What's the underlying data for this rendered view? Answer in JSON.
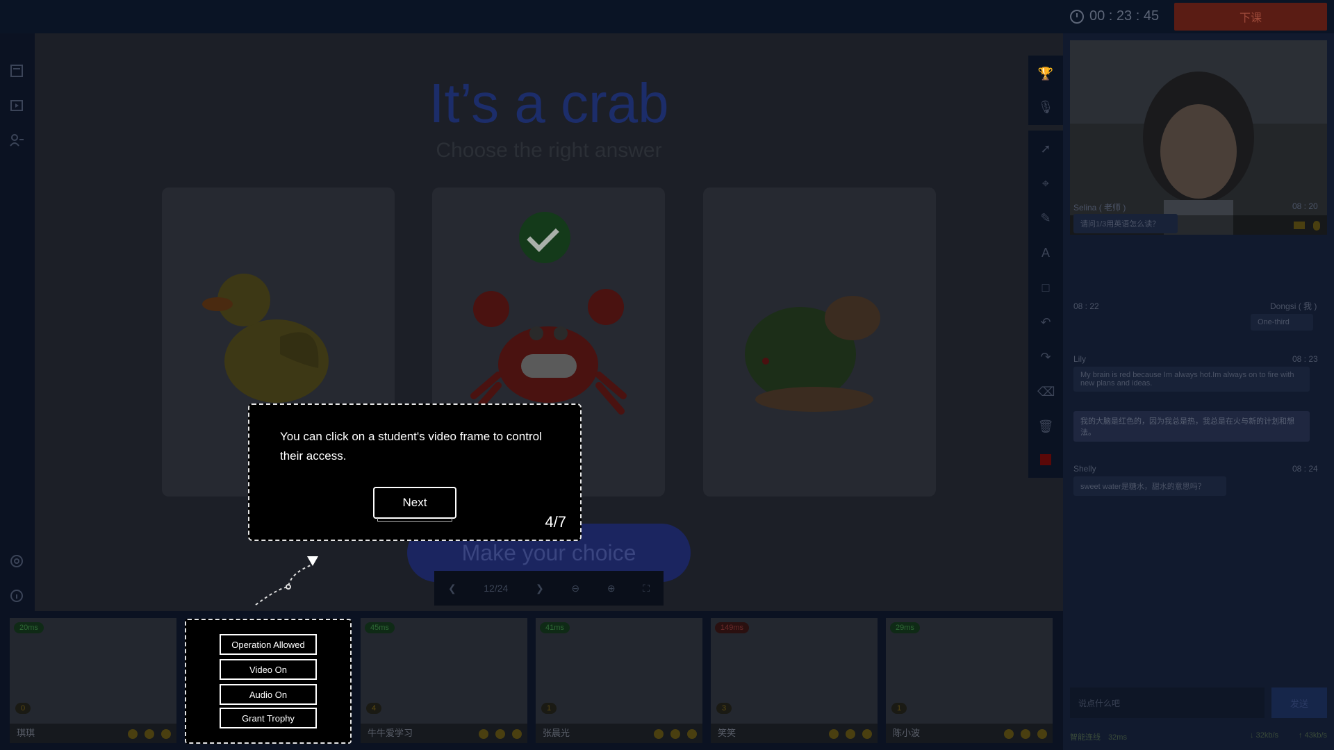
{
  "header": {
    "timer": "00 : 23 : 45",
    "end_class_label": "下课"
  },
  "left_nav": {
    "icons": [
      "courseware-icon",
      "video-icon",
      "students-icon",
      "settings-icon",
      "info-icon"
    ]
  },
  "slide": {
    "title": "It’s a crab",
    "subtitle": "Choose the right answer",
    "choices": [
      {
        "name": "duck",
        "correct": false
      },
      {
        "name": "crab",
        "correct": true
      },
      {
        "name": "turtle",
        "correct": false
      }
    ],
    "choice_button": "Make your choice",
    "page_indicator": "12/24"
  },
  "tooltip": {
    "text": "You can click on a student's video frame to control their access.",
    "next_label": "Next",
    "step": "4/7"
  },
  "student_controls": [
    "Operation Allowed",
    "Video On",
    "Audio On",
    "Grant Trophy"
  ],
  "teacher_video": {
    "name": "Selina"
  },
  "chat": {
    "messages": [
      {
        "sender": "Selina ( 老师 )",
        "time": "08 : 20",
        "text": "请问1/3用英语怎么读？"
      },
      {
        "sender": "Dongsi ( 我 )",
        "time": "08 : 22",
        "text": "One-third"
      },
      {
        "sender": "Lily",
        "time": "08 : 23",
        "text": "My brain is red because Im always hot.Im always on to fire with new plans and ideas.",
        "translation": "我的大脑是红色的，因为我总是热，我总是在火与新的计划和想法。"
      },
      {
        "sender": "Shelly",
        "time": "08 : 24",
        "text": "sweet water是糖水，甜水的意思吗？"
      }
    ],
    "input_placeholder": "说点什么吧",
    "send_label": "发送"
  },
  "status": {
    "connection": "智能连线",
    "latency": "32ms",
    "down": "↓ 32kb/s",
    "up": "↑ 43kb/s"
  },
  "students": [
    {
      "name": "琪琪",
      "ping": "20ms",
      "trophies": "0"
    },
    {
      "name": "",
      "ping": "",
      "trophies": ""
    },
    {
      "name": "牛牛爱学习",
      "ping": "45ms",
      "trophies": "4"
    },
    {
      "name": "张晨光",
      "ping": "41ms",
      "trophies": "1"
    },
    {
      "name": "笑笑",
      "ping": "149ms",
      "trophies": "3"
    },
    {
      "name": "陈小波",
      "ping": "29ms",
      "trophies": "1"
    }
  ]
}
